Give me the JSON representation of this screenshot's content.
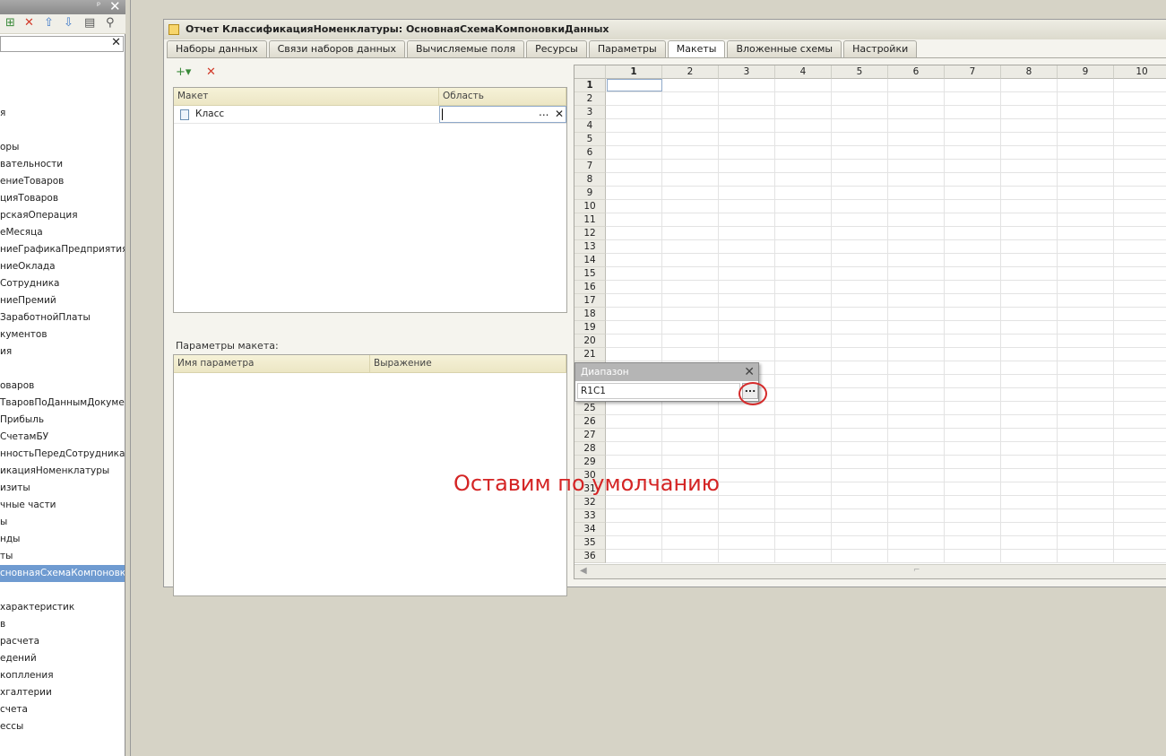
{
  "left_panel": {
    "pin_glyph": "ᵖ",
    "close_glyph": "✕",
    "toolbar_icons": [
      "add-icon",
      "delete-icon",
      "move-up-icon",
      "move-down-icon",
      "list-icon",
      "filter-icon"
    ],
    "search_clear": "✕",
    "items": [
      "я",
      "оры",
      "вательности",
      "ениеТоваров",
      "цияТоваров",
      "рскаяОперация",
      "еМесяца",
      "ниеГрафикаПредприятия",
      "ниеОклада",
      "Сотрудника",
      "ниеПремий",
      "ЗаработнойПлаты",
      "кументов",
      "ия",
      "оваров",
      "ТваровПоДаннымДокумента",
      "Прибыль",
      "СчетамБУ",
      "нностьПередСотрудниками",
      "икацияНоменклатуры",
      "изиты",
      "чные части",
      "ы",
      "нды",
      "ты",
      "сновнаяСхемаКомпоновки",
      "характеристик",
      "в",
      "расчета",
      "едений",
      "коплления",
      "хгалтерии",
      "счета",
      "ессы"
    ]
  },
  "window": {
    "title": "Отчет КлассификацияНоменклатуры: ОсновнаяСхемаКомпоновкиДанных",
    "tabs": [
      "Наборы данных",
      "Связи наборов данных",
      "Вычисляемые поля",
      "Ресурсы",
      "Параметры",
      "Макеты",
      "Вложенные схемы",
      "Настройки"
    ],
    "active_tab": "Макеты"
  },
  "layouts": {
    "add_glyph": "+▾",
    "delete_glyph": "✕",
    "col_layout": "Макет",
    "col_area": "Область",
    "rows": [
      {
        "layout": "Класс",
        "area": ""
      }
    ],
    "area_dots": "...",
    "area_clear": "✕"
  },
  "params": {
    "label": "Параметры макета:",
    "col_name": "Имя параметра",
    "col_expr": "Выражение"
  },
  "sheet": {
    "columns": [
      "1",
      "2",
      "3",
      "4",
      "5",
      "6",
      "7",
      "8",
      "9",
      "10"
    ],
    "rows": [
      "1",
      "2",
      "3",
      "4",
      "5",
      "6",
      "7",
      "8",
      "9",
      "10",
      "11",
      "12",
      "13",
      "14",
      "15",
      "16",
      "17",
      "18",
      "19",
      "20",
      "21",
      "",
      "",
      "",
      "25",
      "26",
      "27",
      "28",
      "29",
      "30",
      "31",
      "32",
      "33",
      "34",
      "35",
      "36"
    ]
  },
  "range_popup": {
    "title": "Диапазон",
    "value": "R1C1",
    "button": "...",
    "close": "✕"
  },
  "annotation": "Оставим по умолчанию"
}
